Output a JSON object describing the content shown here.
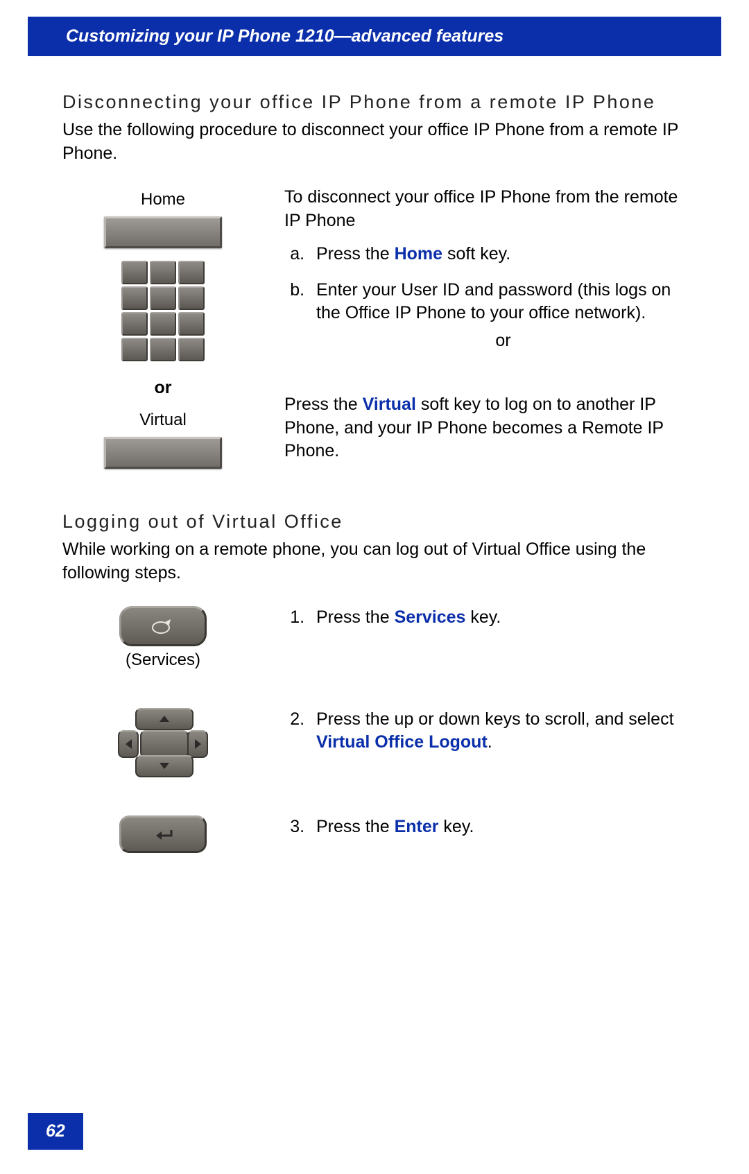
{
  "header": "Customizing your IP Phone 1210—advanced features",
  "page_number": "62",
  "section1": {
    "title": "Disconnecting your office IP Phone from a remote IP Phone",
    "intro": "Use the following procedure to disconnect your office IP Phone from a remote IP Phone.",
    "left": {
      "home_label": "Home",
      "or_label": "or",
      "virtual_label": "Virtual"
    },
    "right": {
      "lead": "To disconnect your office IP Phone from the remote IP Phone",
      "step_a_pre": "Press the ",
      "step_a_key": "Home",
      "step_a_post": " soft key.",
      "step_b": "Enter your User ID and password (this logs on the Office IP Phone to your office network).",
      "or_label": "or",
      "virtual_pre": "Press the ",
      "virtual_key": "Virtual",
      "virtual_post": " soft key to log on to another IP Phone, and your IP Phone becomes a Remote IP Phone."
    }
  },
  "section2": {
    "title": "Logging out of Virtual Office",
    "intro": "While working on a remote phone, you can log out of Virtual Office using the following steps.",
    "step1_pre": "Press the ",
    "step1_key": "Services",
    "step1_post": " key.",
    "services_label": "(Services)",
    "step2_pre": "Press the up or down keys to scroll, and select ",
    "step2_key": "Virtual Office Logout",
    "step2_post": ".",
    "step3_pre": "Press the ",
    "step3_key": "Enter",
    "step3_post": " key."
  }
}
